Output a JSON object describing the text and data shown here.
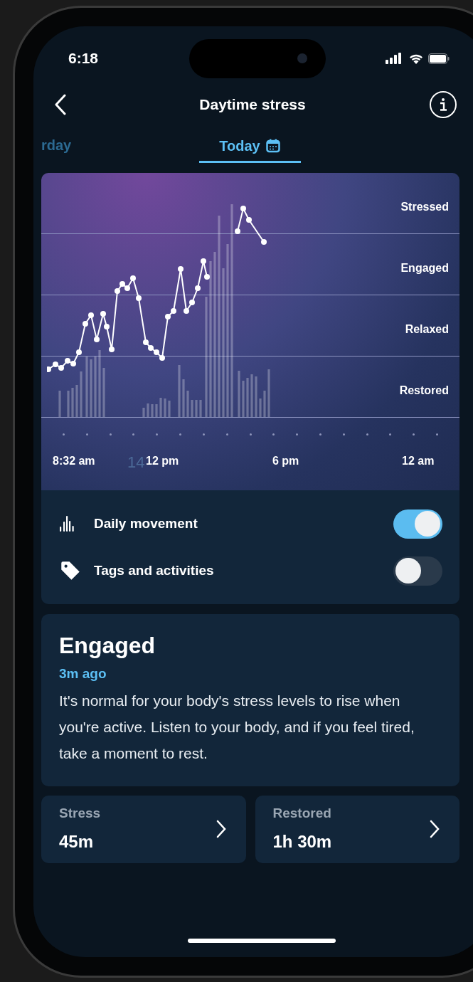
{
  "status_bar": {
    "time": "6:18"
  },
  "header": {
    "title": "Daytime stress"
  },
  "tabs": [
    {
      "label": "rday",
      "selected": false
    },
    {
      "label": "Today",
      "selected": true
    }
  ],
  "chart": {
    "bands": [
      "Stressed",
      "Engaged",
      "Relaxed",
      "Restored"
    ],
    "x_labels": [
      "8:32 am",
      "12 pm",
      "6 pm",
      "12 am"
    ],
    "overlay_text": "14"
  },
  "toggles": [
    {
      "label": "Daily movement",
      "kind": "movement",
      "on": true
    },
    {
      "label": "Tags and activities",
      "kind": "tag",
      "on": false
    }
  ],
  "current_state": {
    "title": "Engaged",
    "time": "3m ago",
    "message": "It's normal for your body's stress levels to rise when you're active. Listen to your body, and if you feel tired, take a moment to rest."
  },
  "summaries": [
    {
      "label": "Stress",
      "value": "45m"
    },
    {
      "label": "Restored",
      "value": "1h 30m"
    }
  ]
}
